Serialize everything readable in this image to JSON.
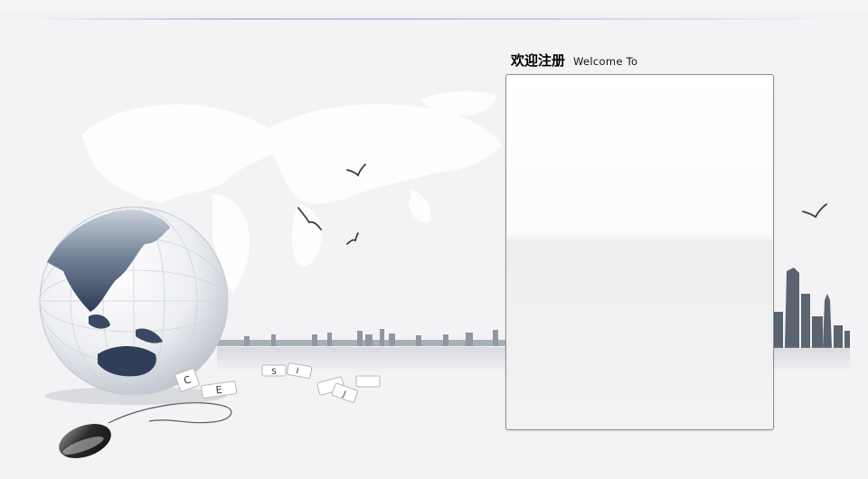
{
  "header": {
    "title_cn": "欢迎注册",
    "title_en": "Welcome To"
  },
  "decor": {
    "key_letters": [
      "C",
      "E",
      "S",
      "I",
      "J"
    ]
  },
  "colors": {
    "background": "#f3f3f5",
    "panel_border": "#8e8e8e",
    "accent_line": "#b9bfe0"
  }
}
